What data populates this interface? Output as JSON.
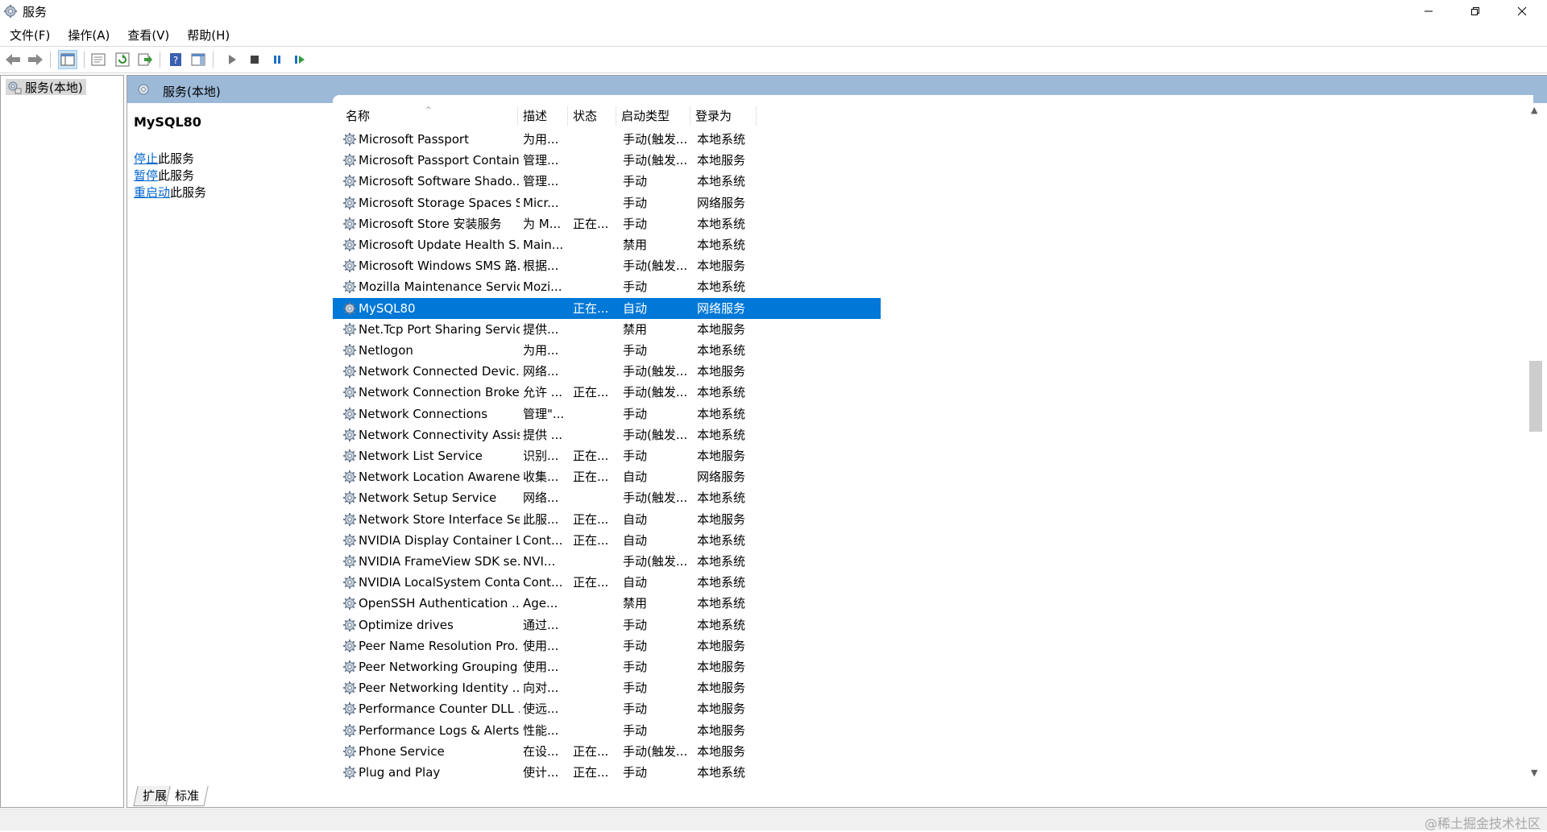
{
  "window": {
    "title": "服务",
    "icon": "gear-icon",
    "controls": [
      "minimize-icon",
      "restore-icon",
      "close-icon"
    ]
  },
  "menu": [
    "文件(F)",
    "操作(A)",
    "查看(V)",
    "帮助(H)"
  ],
  "toolbar": [
    "back-icon",
    "forward-icon",
    "show-console-tree-icon",
    "properties-icon",
    "refresh-icon",
    "export-list-icon",
    "help-icon",
    "action-pane-icon",
    "start-service-icon",
    "stop-service-icon",
    "pause-service-icon",
    "resume-service-icon"
  ],
  "tree": {
    "item": "服务(本地)"
  },
  "main": {
    "header": "服务(本地)",
    "selected_service": "MySQL80",
    "actions": [
      {
        "link": "停止",
        "text": "此服务"
      },
      {
        "link": "暂停",
        "text": "此服务"
      },
      {
        "link": "重启动",
        "text": "此服务"
      }
    ],
    "columns": [
      "名称",
      "描述",
      "状态",
      "启动类型",
      "登录为"
    ],
    "rows": [
      {
        "name": "Microsoft Passport",
        "desc": "为用...",
        "status": "",
        "start": "手动(触发...",
        "logon": "本地系统"
      },
      {
        "name": "Microsoft Passport Container",
        "desc": "管理...",
        "status": "",
        "start": "手动(触发...",
        "logon": "本地服务"
      },
      {
        "name": "Microsoft Software Shado...",
        "desc": "管理...",
        "status": "",
        "start": "手动",
        "logon": "本地系统"
      },
      {
        "name": "Microsoft Storage Spaces S...",
        "desc": "Micr...",
        "status": "",
        "start": "手动",
        "logon": "网络服务"
      },
      {
        "name": "Microsoft Store 安装服务",
        "desc": "为 M...",
        "status": "正在...",
        "start": "手动",
        "logon": "本地系统"
      },
      {
        "name": "Microsoft Update Health S...",
        "desc": "Main...",
        "status": "",
        "start": "禁用",
        "logon": "本地系统"
      },
      {
        "name": "Microsoft Windows SMS 路...",
        "desc": "根据...",
        "status": "",
        "start": "手动(触发...",
        "logon": "本地服务"
      },
      {
        "name": "Mozilla Maintenance Service",
        "desc": "Mozi...",
        "status": "",
        "start": "手动",
        "logon": "本地系统"
      },
      {
        "name": "MySQL80",
        "desc": "",
        "status": "正在...",
        "start": "自动",
        "logon": "网络服务",
        "selected": true
      },
      {
        "name": "Net.Tcp Port Sharing Service",
        "desc": "提供...",
        "status": "",
        "start": "禁用",
        "logon": "本地服务"
      },
      {
        "name": "Netlogon",
        "desc": "为用...",
        "status": "",
        "start": "手动",
        "logon": "本地系统"
      },
      {
        "name": "Network Connected Devic...",
        "desc": "网络...",
        "status": "",
        "start": "手动(触发...",
        "logon": "本地服务"
      },
      {
        "name": "Network Connection Broker",
        "desc": "允许 ...",
        "status": "正在...",
        "start": "手动(触发...",
        "logon": "本地系统"
      },
      {
        "name": "Network Connections",
        "desc": "管理\"...",
        "status": "",
        "start": "手动",
        "logon": "本地系统"
      },
      {
        "name": "Network Connectivity Assis...",
        "desc": "提供 ...",
        "status": "",
        "start": "手动(触发...",
        "logon": "本地系统"
      },
      {
        "name": "Network List Service",
        "desc": "识别...",
        "status": "正在...",
        "start": "手动",
        "logon": "本地服务"
      },
      {
        "name": "Network Location Awarene...",
        "desc": "收集...",
        "status": "正在...",
        "start": "自动",
        "logon": "网络服务"
      },
      {
        "name": "Network Setup Service",
        "desc": "网络...",
        "status": "",
        "start": "手动(触发...",
        "logon": "本地系统"
      },
      {
        "name": "Network Store Interface Se...",
        "desc": "此服...",
        "status": "正在...",
        "start": "自动",
        "logon": "本地服务"
      },
      {
        "name": "NVIDIA Display Container LS",
        "desc": "Cont...",
        "status": "正在...",
        "start": "自动",
        "logon": "本地系统"
      },
      {
        "name": "NVIDIA FrameView SDK se...",
        "desc": "NVI...",
        "status": "",
        "start": "手动(触发...",
        "logon": "本地系统"
      },
      {
        "name": "NVIDIA LocalSystem Conta...",
        "desc": "Cont...",
        "status": "正在...",
        "start": "自动",
        "logon": "本地系统"
      },
      {
        "name": "OpenSSH Authentication ...",
        "desc": "Age...",
        "status": "",
        "start": "禁用",
        "logon": "本地系统"
      },
      {
        "name": "Optimize drives",
        "desc": "通过...",
        "status": "",
        "start": "手动",
        "logon": "本地系统"
      },
      {
        "name": "Peer Name Resolution Pro...",
        "desc": "使用...",
        "status": "",
        "start": "手动",
        "logon": "本地服务"
      },
      {
        "name": "Peer Networking Grouping",
        "desc": "使用...",
        "status": "",
        "start": "手动",
        "logon": "本地服务"
      },
      {
        "name": "Peer Networking Identity ...",
        "desc": "向对...",
        "status": "",
        "start": "手动",
        "logon": "本地服务"
      },
      {
        "name": "Performance Counter DLL ...",
        "desc": "使远...",
        "status": "",
        "start": "手动",
        "logon": "本地服务"
      },
      {
        "name": "Performance Logs & Alerts",
        "desc": "性能...",
        "status": "",
        "start": "手动",
        "logon": "本地服务"
      },
      {
        "name": "Phone Service",
        "desc": "在设...",
        "status": "正在...",
        "start": "手动(触发...",
        "logon": "本地服务"
      },
      {
        "name": "Plug and Play",
        "desc": "使计...",
        "status": "正在...",
        "start": "手动",
        "logon": "本地系统"
      }
    ]
  },
  "tabs": [
    "扩展",
    "标准"
  ],
  "statusbar": {
    "watermark": "@稀土掘金技术社区"
  },
  "colors": {
    "selection": "#0078d7",
    "header_band": "#9cb9d8",
    "link": "#0066cc"
  }
}
